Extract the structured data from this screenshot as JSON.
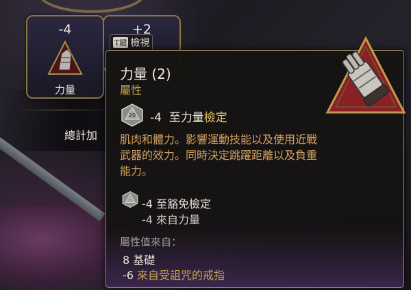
{
  "stat_card": {
    "value": "-4",
    "name": "力量"
  },
  "stat_card_next": {
    "value": "+2"
  },
  "inspect_hint": {
    "key": "T鍵",
    "label": "檢視"
  },
  "total_row": {
    "label": "總計加"
  },
  "tooltip": {
    "title": "力量 (2)",
    "category": "屬性",
    "check_main": {
      "value": "-4",
      "label": "至力量",
      "highlight": "檢定"
    },
    "description": "肌肉和體力。影響運動技能以及使用近戰武器的效力。同時決定跳躍距離以及負重能力。",
    "check_sub": {
      "line": "-4 至豁免檢定",
      "source": "-4 來自力量"
    },
    "sources_header": "屬性值來自：",
    "sources": [
      {
        "value": "8",
        "label": "基礎"
      },
      {
        "value": "-6",
        "label": "來自受詛咒的戒指"
      }
    ],
    "die_label": "20"
  },
  "colors": {
    "gold": "#c8a652",
    "border": "#9a8a62",
    "desc": "#d2a262",
    "emblem_red": "#8a1f24"
  }
}
